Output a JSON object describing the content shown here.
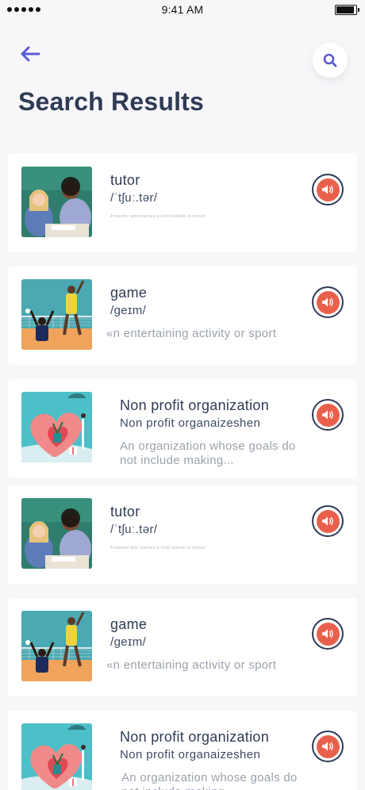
{
  "status_bar": {
    "time": "9:41 AM"
  },
  "header": {
    "title": "Search Results"
  },
  "results": [
    {
      "word": "tutor",
      "phonetic": "/ˈtʃuː.tər/",
      "definition": "A teacher who teaches a child outside of school",
      "image": "teacher-child-photo"
    },
    {
      "word": "game",
      "phonetic": "/ɡeɪm/",
      "definition": "«n entertaining activity or sport",
      "image": "volleyball-photo"
    },
    {
      "word": "Non profit organization",
      "phonetic": "Non profit organaizeshen",
      "definition": "An organization whose goals do not include making...",
      "image": "charity-heart-illustration"
    },
    {
      "word": "tutor",
      "phonetic": "/ˈtʃuː.tər/",
      "definition": "A teacher who teaches a child outside of school",
      "image": "teacher-child-photo"
    },
    {
      "word": "game",
      "phonetic": "/ɡeɪm/",
      "definition": "«n entertaining activity or sport",
      "image": "volleyball-photo"
    },
    {
      "word": "Non profit organization",
      "phonetic": "Non profit organaizeshen",
      "definition": "An organization whose goals do not include making...",
      "image": "charity-heart-illustration"
    }
  ],
  "colors": {
    "accent": "#e8604c",
    "title": "#2f3b55",
    "back_arrow": "#5b5bd6"
  }
}
